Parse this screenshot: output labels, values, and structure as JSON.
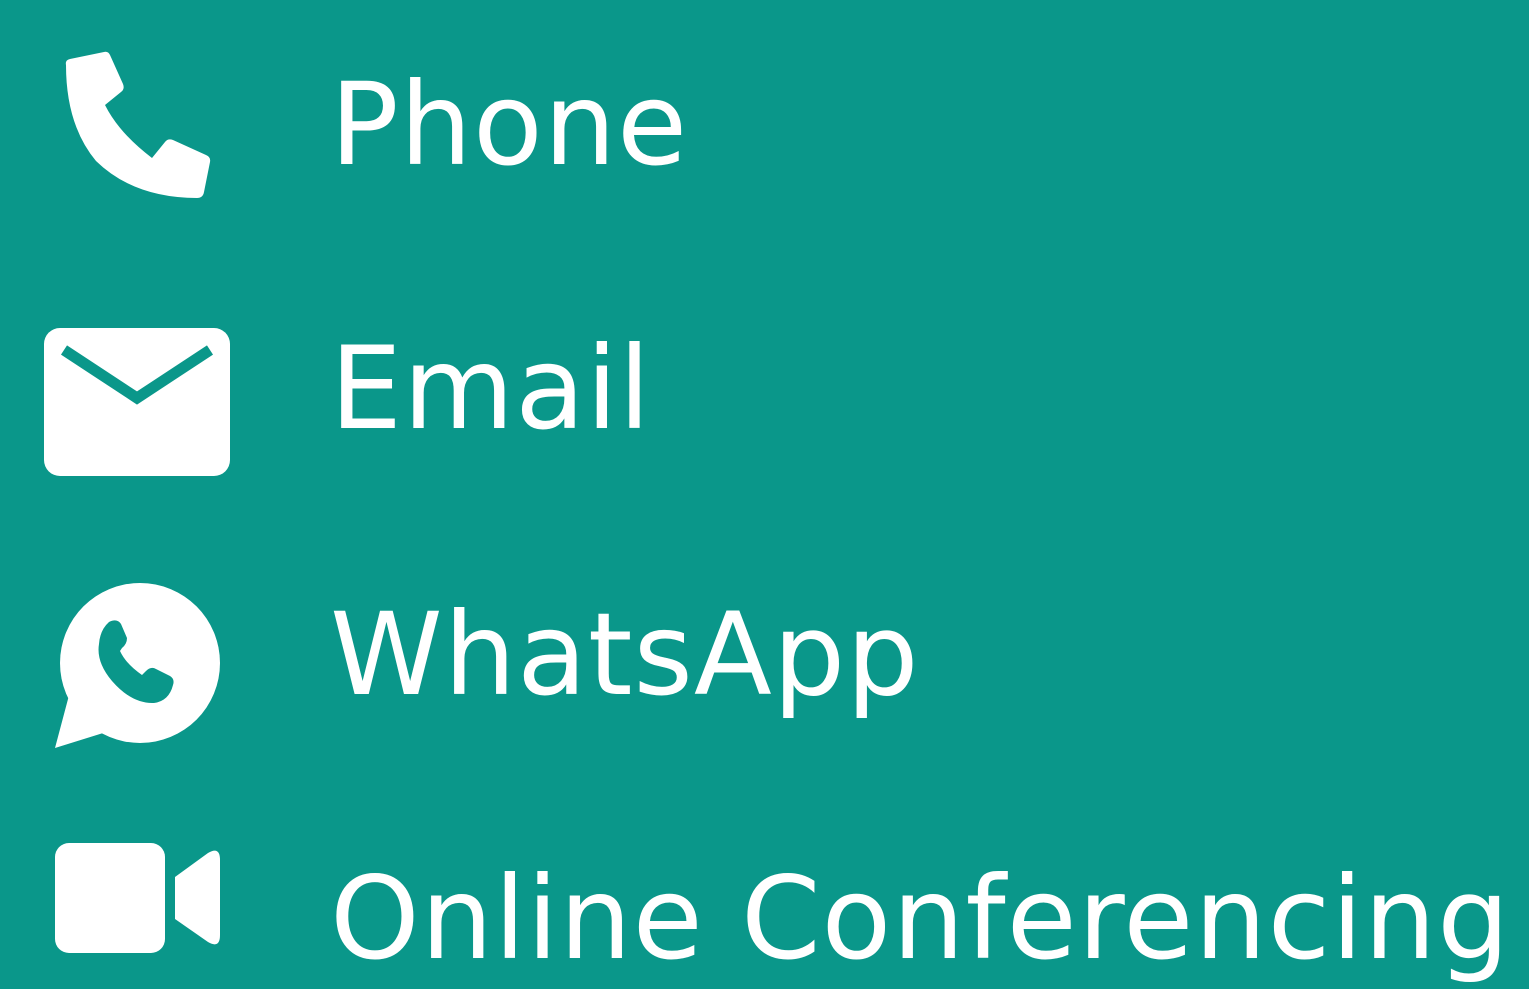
{
  "colors": {
    "background": "#0a978a",
    "foreground": "#ffffff"
  },
  "items": [
    {
      "label": "Phone",
      "icon": "phone-icon"
    },
    {
      "label": "Email",
      "icon": "envelope-icon"
    },
    {
      "label": "WhatsApp",
      "icon": "whatsapp-icon"
    },
    {
      "label": "Online Conferencing",
      "icon": "video-camera-icon"
    }
  ]
}
